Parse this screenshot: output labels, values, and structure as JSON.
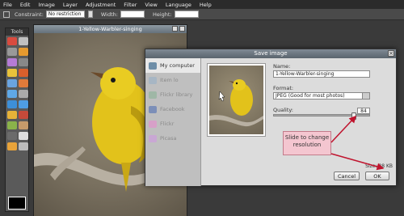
{
  "menu": {
    "items": [
      "File",
      "Edit",
      "Image",
      "Layer",
      "Adjustment",
      "Filter",
      "View",
      "Language",
      "Help"
    ]
  },
  "toolbar": {
    "constraint_label": "Constraint:",
    "constraint_value": "No restriction",
    "width_label": "Width:",
    "height_label": "Height:"
  },
  "tools": {
    "title": "Tools"
  },
  "document": {
    "title": "1-Yellow-Warbler-singing"
  },
  "dialog": {
    "title": "Save image",
    "sidebar": [
      "My computer",
      "Item lo",
      "Flickr library",
      "Facebook",
      "Flickr",
      "Picasa"
    ],
    "name_label": "Name:",
    "name_value": "1-Yellow-Warbler-singing",
    "format_label": "Format:",
    "format_value": "JPEG (Good for most photos)",
    "quality_label": "Quality:",
    "quality_value": "84",
    "size_text": "Size: 88 KB",
    "cancel_label": "Cancel",
    "ok_label": "OK"
  },
  "callout": {
    "text": "Slide to change resolution"
  },
  "colors": {
    "accent": "#c0142e",
    "callout_bg": "#f4c6d0",
    "warbler_yellow": "#e2c21b"
  }
}
